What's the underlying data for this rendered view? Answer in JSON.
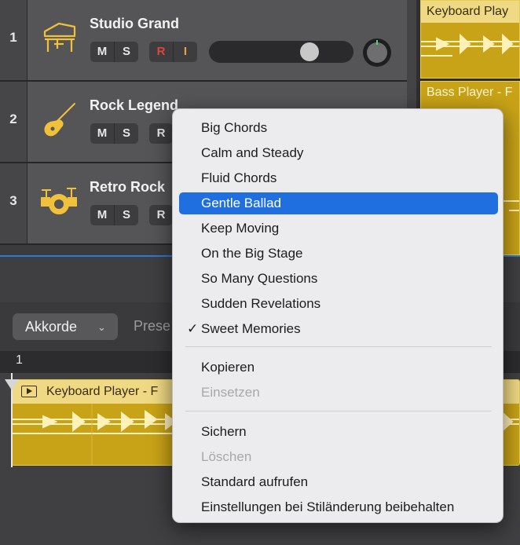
{
  "tracks": [
    {
      "number": "1",
      "name": "Studio Grand",
      "icon": "piano-icon",
      "mute": "M",
      "solo": "S",
      "record": "R",
      "input": "I"
    },
    {
      "number": "2",
      "name": "Rock Legend",
      "icon": "guitar-icon",
      "mute": "M",
      "solo": "S",
      "record": "R"
    },
    {
      "number": "3",
      "name": "Retro Rock",
      "icon": "drum-kit-icon",
      "mute": "M",
      "solo": "S",
      "record": "R"
    }
  ],
  "regions": {
    "keyboard_title": "Keyboard Play",
    "bass_title": "Bass Player - F"
  },
  "editor": {
    "akkorde_label": "Akkorde",
    "preset_label": "Prese",
    "ruler_bar": "1",
    "chord_region_title": "Keyboard Player - F"
  },
  "menu": {
    "presets": [
      "Big Chords",
      "Calm and Steady",
      "Fluid Chords",
      "Gentle Ballad",
      "Keep Moving",
      "On the Big Stage",
      "So Many Questions",
      "Sudden Revelations",
      "Sweet Memories"
    ],
    "highlighted": "Gentle Ballad",
    "checked": "Sweet Memories",
    "checkmark": "✓",
    "copy": "Kopieren",
    "paste": "Einsetzen",
    "save": "Sichern",
    "delete": "Löschen",
    "default": "Standard aufrufen",
    "keep_settings": "Einstellungen bei Stiländerung beibehalten"
  },
  "colors": {
    "region_yellow": "#c9a317",
    "selection_blue": "#1f6fe0",
    "record_red": "#e0443a",
    "input_orange": "#e8a23a",
    "pan_indicator": "#4cd964",
    "icon_yellow": "#f2c13c"
  }
}
